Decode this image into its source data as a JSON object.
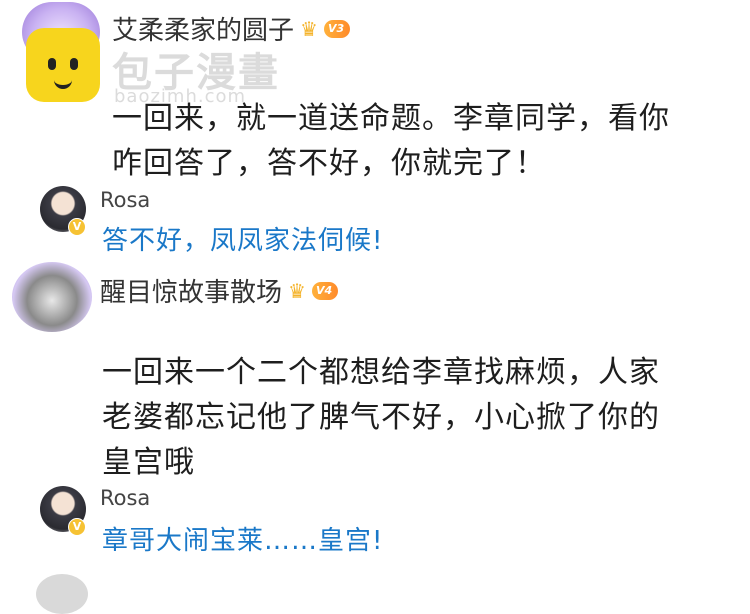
{
  "watermark": {
    "title": "包子漫畫",
    "url": "baozimh.com"
  },
  "comments": [
    {
      "username": "艾柔柔家的圆子",
      "level": "V3",
      "lines": [
        "一回来，就一道送命题。李章同学，看你",
        "咋回答了，答不好，你就完了！"
      ],
      "reply": {
        "name": "Rosa",
        "text": "答不好，凤凤家法伺候!"
      }
    },
    {
      "username": "醒目惊故事散场",
      "level": "V4",
      "lines": [
        "一回来一个二个都想给李章找麻烦，人家",
        "老婆都忘记他了脾气不好，小心掀了你的",
        "皇宫哦"
      ],
      "reply": {
        "name": "Rosa",
        "text": "章哥大闹宝莱……皇宫!"
      }
    }
  ],
  "badges": {
    "verified_mark": "V"
  },
  "colors": {
    "reply_text": "#1a78c8",
    "level_badge": "#ff8a2a",
    "watermark_logo": "#f7d51d"
  }
}
